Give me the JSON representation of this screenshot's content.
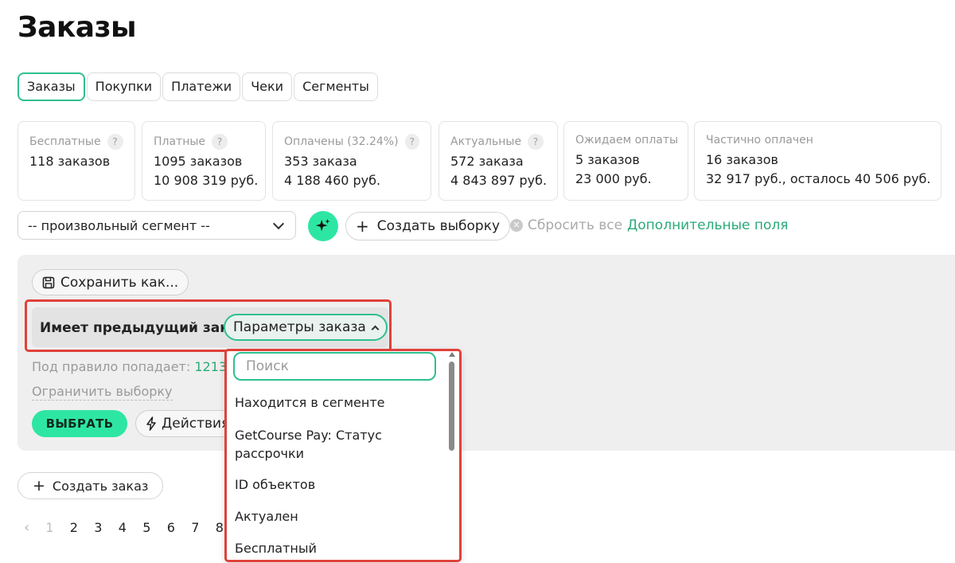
{
  "page": {
    "title": "Заказы"
  },
  "tabs": [
    {
      "label": "Заказы",
      "active": true
    },
    {
      "label": "Покупки",
      "active": false
    },
    {
      "label": "Платежи",
      "active": false
    },
    {
      "label": "Чеки",
      "active": false
    },
    {
      "label": "Сегменты",
      "active": false
    }
  ],
  "stats": [
    {
      "label": "Бесплатные",
      "help": "?",
      "lines": [
        "118 заказов"
      ]
    },
    {
      "label": "Платные",
      "help": "?",
      "lines": [
        "1095 заказов",
        "10 908 319 руб."
      ]
    },
    {
      "label": "Оплачены (32.24%)",
      "help": "?",
      "lines": [
        "353 заказа",
        "4 188 460 руб."
      ]
    },
    {
      "label": "Актуальные",
      "help": "?",
      "lines": [
        "572 заказа",
        "4 843 897 руб."
      ]
    },
    {
      "label": "Ожидаем оплаты",
      "lines": [
        "5 заказов",
        "23 000 руб."
      ]
    },
    {
      "label": "Частично оплачен",
      "lines": [
        "16 заказов",
        "32 917 руб., осталось 40 506 руб."
      ]
    }
  ],
  "filters": {
    "segment_select": "-- произвольный сегмент --",
    "create_selection": "Создать выборку",
    "reset_all": "Сбросить все",
    "extra_fields": "Дополнительные поля"
  },
  "panel": {
    "save_as": "Сохранить как...",
    "rule_label": "Имеет предыдущий заказ",
    "params_button": "Параметры заказа",
    "rule_count_label": "Под правило попадает:",
    "rule_count_value": "1213",
    "limit_selection": "Ограничить выборку",
    "select_button": "ВЫБРАТЬ",
    "actions_button": "Действия"
  },
  "dropdown": {
    "search_placeholder": "Поиск",
    "items": [
      "Находится в сегменте",
      "GetCourse Pay: Статус рассрочки",
      "ID объектов",
      "Актуален",
      "Бесплатный"
    ]
  },
  "create_order": "Создать заказ",
  "pagination": {
    "pages": [
      "1",
      "2",
      "3",
      "4",
      "5",
      "6",
      "7",
      "8"
    ],
    "current": "1"
  },
  "colors": {
    "accent": "#2ee6a3",
    "accent_text": "#2aaa78",
    "highlight": "#e0413a"
  }
}
